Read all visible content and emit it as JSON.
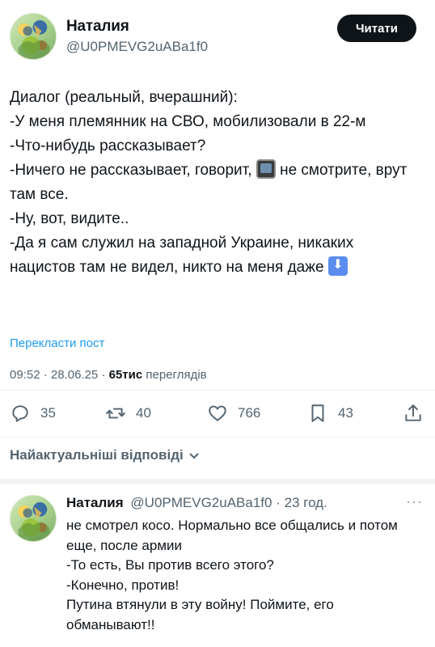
{
  "tweet": {
    "author_name": "Наталия",
    "author_handle": "@U0PMEVG2uABa1f0",
    "follow_label": "Читати",
    "text_part1": "Диалог (реальный, вчерашний):\n-У меня племянник на СВО, мобилизовали в 22-м\n-Что-нибудь рассказывает?\n-Ничего не рассказывает, говорит, ",
    "emoji_tv": "tv-emoji",
    "text_part2": " не смотрите, врут там все.\n-Ну, вот, видите..\n-Да я сам служил на западной Украине, никаких нацистов там не видел, никто на меня даже ",
    "emoji_down": "down-arrow-emoji",
    "translate_label": "Перекласти пост",
    "time": "09:52",
    "date": "28.06.25",
    "views_count": "65тис",
    "views_label": "переглядів"
  },
  "actions": {
    "reply_count": "35",
    "repost_count": "40",
    "like_count": "766",
    "bookmark_count": "43",
    "icons": [
      "reply-icon",
      "repost-icon",
      "like-icon",
      "bookmark-icon",
      "share-icon"
    ]
  },
  "replies": {
    "sort_label": "Найактуальніші відповіді"
  },
  "reply": {
    "author_name": "Наталия",
    "author_handle": "@U0PMEVG2uABa1f0",
    "age": "23 год.",
    "text": "не смотрел косо. Нормально все общались и потом еще, после армии\n-То есть, Вы против всего этого?\n-Конечно, против!\nПутина втянули в эту войну! Поймите, его обманывают!!"
  },
  "colors": {
    "text": "#0f1419",
    "secondary": "#536471",
    "link": "#1d9bf0",
    "divider": "#eff3f4"
  }
}
